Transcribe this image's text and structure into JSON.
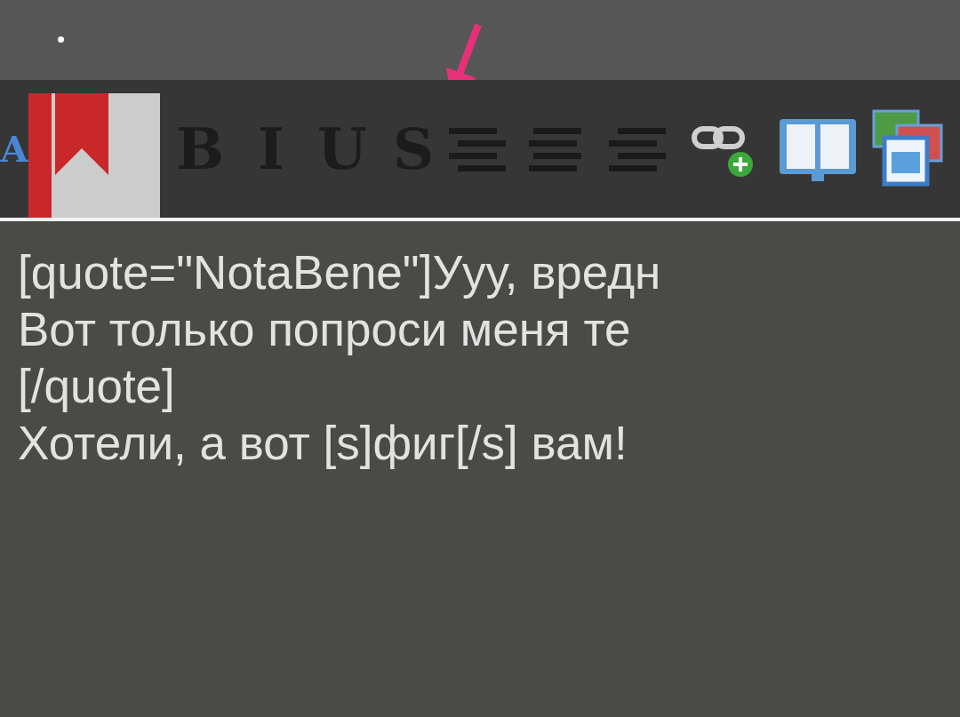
{
  "toolbar": {
    "buttons": [
      {
        "kind": "accent-glyph",
        "label": "A"
      },
      {
        "kind": "glyph",
        "label": "B"
      },
      {
        "kind": "glyph",
        "label": "I"
      },
      {
        "kind": "glyph",
        "label": "U"
      },
      {
        "kind": "glyph",
        "label": "S"
      },
      {
        "kind": "align-left"
      },
      {
        "kind": "align-center"
      },
      {
        "kind": "align-right"
      },
      {
        "kind": "link"
      },
      {
        "kind": "book"
      },
      {
        "kind": "windows"
      }
    ]
  },
  "editor": {
    "lines": [
      "[quote=\"NotaBene\"]Ууу, вредн",
      "Вот только попроси меня те",
      "[/quote]",
      "Хотели, а вот [s]фиг[/s] вам!"
    ]
  }
}
